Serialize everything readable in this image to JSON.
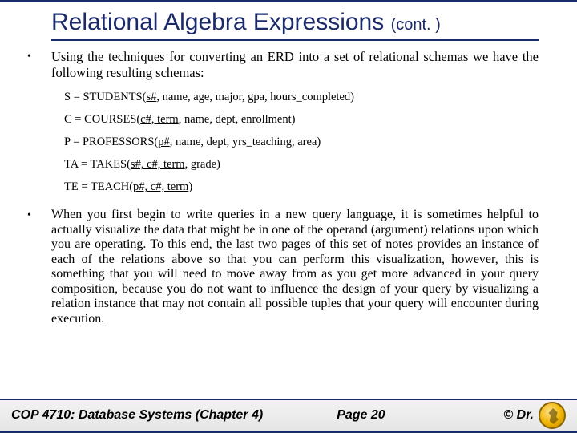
{
  "title": {
    "main": "Relational Algebra Expressions ",
    "cont": "(cont. )"
  },
  "bullets": {
    "b1": "Using the techniques for converting an ERD into a set of relational schemas we have the following resulting schemas:",
    "b2": "When you first begin to write queries in a new query language, it is sometimes helpful to actually visualize the data that might be in one of the operand (argument) relations upon which you are operating.  To this end, the last two pages of this set of notes provides an instance of each of the relations above so that you can perform this visualization, however, this is something that you will need to move away from as you get more advanced in your query composition, because you do not want to influence the design of your query by visualizing a relation instance that may not contain all possible tuples that your query will encounter during execution."
  },
  "schemas": {
    "s1": {
      "lhs": "S = STUDENTS(",
      "key": "s#",
      "rest": ", name, age, major, gpa, hours_completed)"
    },
    "s2": {
      "lhs": "C = COURSES(",
      "key": "c#, term",
      "rest": ", name, dept, enrollment)"
    },
    "s3": {
      "lhs": "P = PROFESSORS(",
      "key": "p#",
      "rest": ", name, dept, yrs_teaching, area)"
    },
    "s4": {
      "lhs": "TA = TAKES(",
      "key": "s#, c#, term",
      "rest": ", grade)"
    },
    "s5": {
      "lhs": "TE = TEACH(",
      "key": "p#, c#, term",
      "rest": ")"
    }
  },
  "footer": {
    "course": "COP 4710: Database Systems  (Chapter 4)",
    "page": "Page 20",
    "copyright": "© Dr."
  }
}
